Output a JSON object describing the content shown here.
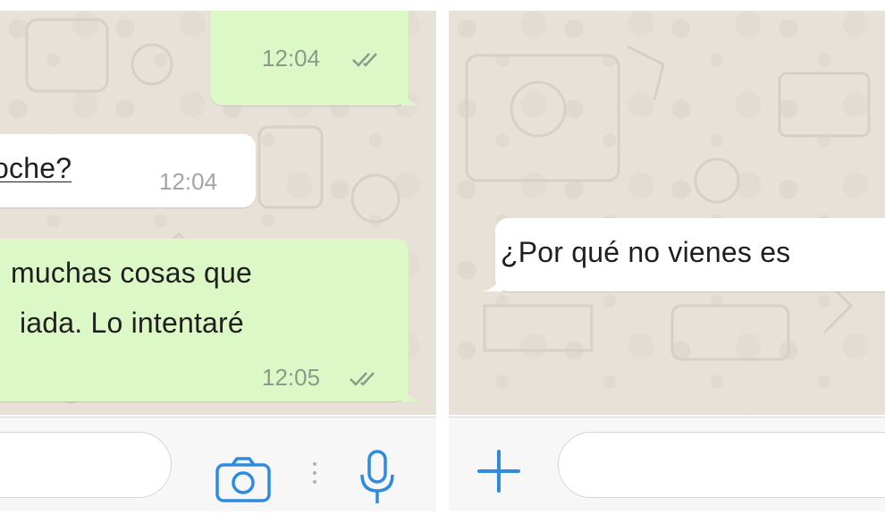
{
  "left_panel": {
    "messages": [
      {
        "direction": "outgoing",
        "lines": [],
        "time": "12:04",
        "status": "read-double-check"
      },
      {
        "direction": "incoming",
        "lines": [
          "oche?"
        ],
        "time": "12:04"
      },
      {
        "direction": "outgoing",
        "lines": [
          "muchas cosas que",
          "iada. Lo intentaré"
        ],
        "time": "12:05",
        "status": "read-double-check"
      }
    ],
    "input": {
      "placeholder": ""
    },
    "buttons": {
      "camera": "camera-icon",
      "mic": "microphone-icon"
    }
  },
  "right_panel": {
    "messages": [
      {
        "direction": "incoming",
        "lines": [
          "¿Por qué no vienes es"
        ]
      }
    ],
    "input": {
      "placeholder": ""
    },
    "buttons": {
      "attach": "plus-icon"
    }
  },
  "colors": {
    "outgoing_bubble": "#dcf8c6",
    "incoming_bubble": "#ffffff",
    "wallpaper": "#e8e1d8",
    "accent_blue": "#2f8be0",
    "ticks": "#8c9a8c"
  }
}
